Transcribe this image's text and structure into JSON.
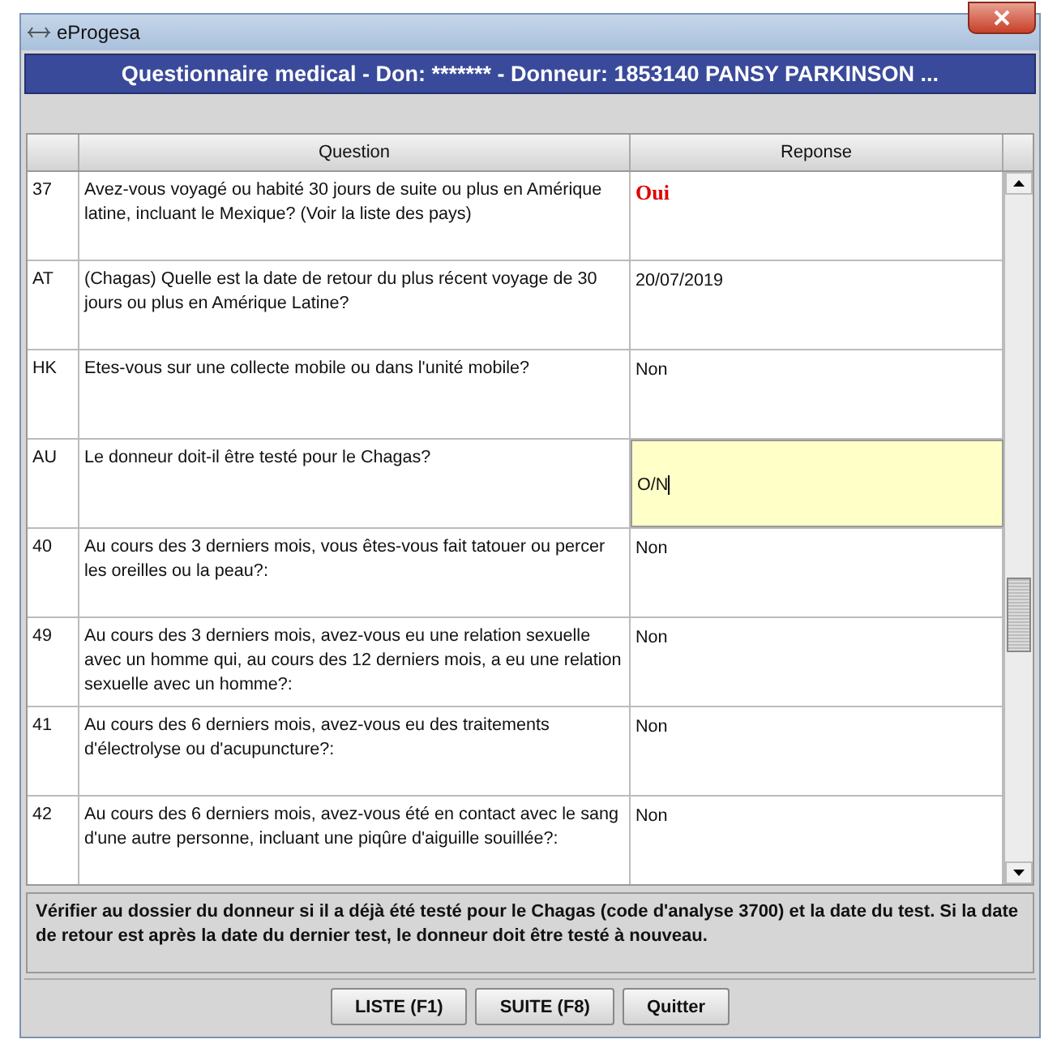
{
  "window": {
    "title": "eProgesa"
  },
  "header": "Questionnaire medical - Don: ******* - Donneur: 1853140 PANSY PARKINSON ...",
  "table": {
    "columns": [
      "Question",
      "Reponse"
    ],
    "rows": [
      {
        "code": "37",
        "question": "Avez-vous voyagé ou habité 30 jours de suite ou plus en Amérique latine, incluant le Mexique? (Voir la liste des pays)",
        "answer": "Oui",
        "flagged": true,
        "editing": false
      },
      {
        "code": "AT",
        "question": "(Chagas) Quelle est la date de retour du plus récent voyage de 30 jours ou plus en Amérique Latine?",
        "answer": "20/07/2019",
        "flagged": false,
        "editing": false
      },
      {
        "code": "HK",
        "question": "Etes-vous sur une collecte mobile ou dans l'unité mobile?",
        "answer": "Non",
        "flagged": false,
        "editing": false
      },
      {
        "code": "AU",
        "question": "Le donneur doit-il être testé pour le Chagas?",
        "answer": "O/N",
        "flagged": false,
        "editing": true
      },
      {
        "code": "40",
        "question": "Au cours des 3 derniers mois, vous êtes-vous fait tatouer ou percer les oreilles ou la peau?:",
        "answer": "Non",
        "flagged": false,
        "editing": false
      },
      {
        "code": "49",
        "question": "Au cours des 3 derniers mois, avez-vous eu une relation sexuelle avec un homme qui, au cours des 12 derniers mois, a eu une relation sexuelle avec un homme?:",
        "answer": "Non",
        "flagged": false,
        "editing": false
      },
      {
        "code": "41",
        "question": "Au cours des 6 derniers mois, avez-vous eu des traitements d'électrolyse ou d'acupuncture?:",
        "answer": "Non",
        "flagged": false,
        "editing": false
      },
      {
        "code": "42",
        "question": "Au cours des 6 derniers mois, avez-vous été en contact avec le sang d'une autre personne, incluant une piqûre d'aiguille souillée?:",
        "answer": "Non",
        "flagged": false,
        "editing": false
      }
    ]
  },
  "note": "Vérifier au dossier du donneur si il a déjà été testé pour le Chagas (code d'analyse 3700) et la date du test. Si la date de retour est après la date du dernier test, le donneur doit être testé à nouveau.",
  "buttons": [
    "LISTE (F1)",
    "SUITE (F8)",
    "Quitter"
  ]
}
